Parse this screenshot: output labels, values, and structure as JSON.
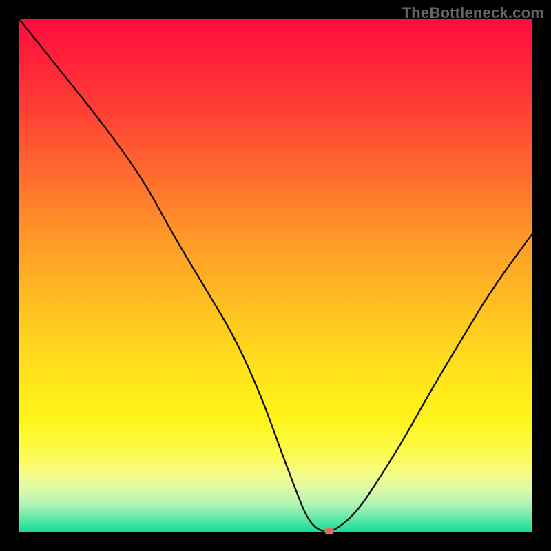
{
  "watermark": "TheBottleneck.com",
  "chart_data": {
    "type": "line",
    "title": "",
    "xlabel": "",
    "ylabel": "",
    "xlim": [
      0,
      100
    ],
    "ylim": [
      0,
      100
    ],
    "x": [
      0,
      8,
      16,
      24,
      30,
      36,
      42,
      47,
      51,
      54,
      56,
      58,
      60,
      62,
      66,
      70,
      75,
      80,
      86,
      92,
      100
    ],
    "values": [
      100,
      90,
      80,
      69,
      58,
      48,
      38,
      27,
      16,
      8,
      3,
      0.5,
      0,
      0.5,
      4,
      10,
      18,
      27,
      37,
      47,
      58
    ],
    "min_marker": {
      "x": 60.5,
      "y": 0
    },
    "grid": false,
    "legend": false,
    "background": "red-to-green vertical gradient (high=red, low=green)"
  },
  "colors": {
    "frame": "#000000",
    "curve": "#111111",
    "marker": "#d86b6b",
    "watermark": "#666666"
  }
}
